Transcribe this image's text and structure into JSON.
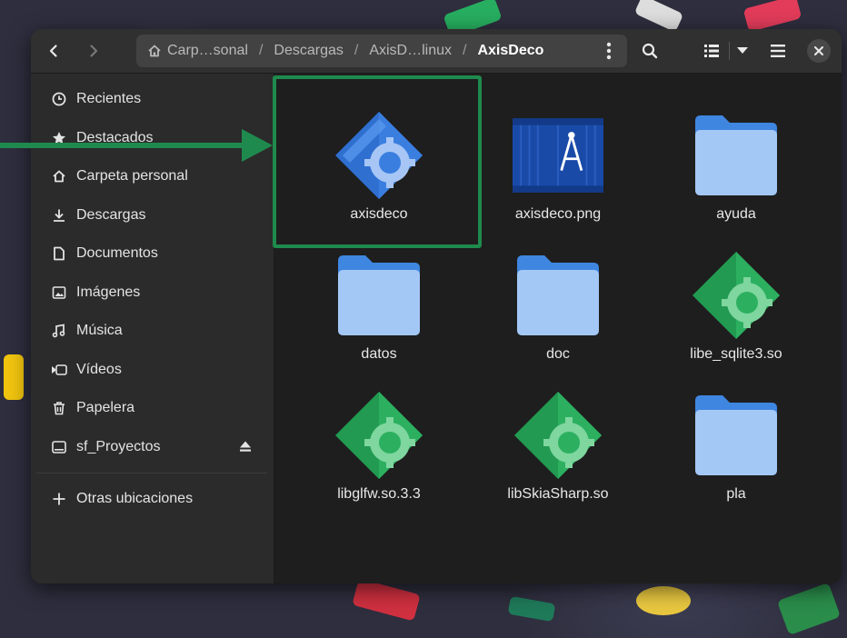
{
  "headerbar": {
    "back_icon": "chevron-left-icon",
    "forward_icon": "chevron-right-icon",
    "path": [
      "Carp…sonal",
      "Descargas",
      "AxisD…linux",
      "AxisDeco"
    ],
    "home_icon": "home-icon",
    "menu_icon": "kebab-menu-icon",
    "search_icon": "search-icon",
    "view_icon": "list-view-icon",
    "sort_icon": "dropdown-icon",
    "hamburger_icon": "hamburger-menu-icon",
    "close_icon": "close-icon"
  },
  "sidebar": {
    "items": [
      {
        "label": "Recientes",
        "icon": "clock-icon"
      },
      {
        "label": "Destacados",
        "icon": "star-icon"
      },
      {
        "label": "Carpeta personal",
        "icon": "home-icon"
      },
      {
        "label": "Descargas",
        "icon": "download-icon"
      },
      {
        "label": "Documentos",
        "icon": "document-icon"
      },
      {
        "label": "Imágenes",
        "icon": "image-icon"
      },
      {
        "label": "Música",
        "icon": "music-icon"
      },
      {
        "label": "Vídeos",
        "icon": "video-icon"
      },
      {
        "label": "Papelera",
        "icon": "trash-icon"
      },
      {
        "label": "sf_Proyectos",
        "icon": "drive-icon"
      }
    ],
    "other_locations": "Otras ubicaciones"
  },
  "files": [
    {
      "name": "axisdeco",
      "type": "executable",
      "color": "#2f6fd0"
    },
    {
      "name": "axisdeco.png",
      "type": "image"
    },
    {
      "name": "ayuda",
      "type": "folder"
    },
    {
      "name": "datos",
      "type": "folder"
    },
    {
      "name": "doc",
      "type": "folder"
    },
    {
      "name": "libe_sqlite3.so",
      "type": "library",
      "color": "#2aa65a"
    },
    {
      "name": "libglfw.so.3.3",
      "type": "library",
      "color": "#2aa65a"
    },
    {
      "name": "libSkiaSharp.so",
      "type": "library",
      "color": "#2aa65a"
    },
    {
      "name": "pla",
      "type": "folder"
    }
  ],
  "annotation": {
    "color": "#1f8a4d"
  }
}
